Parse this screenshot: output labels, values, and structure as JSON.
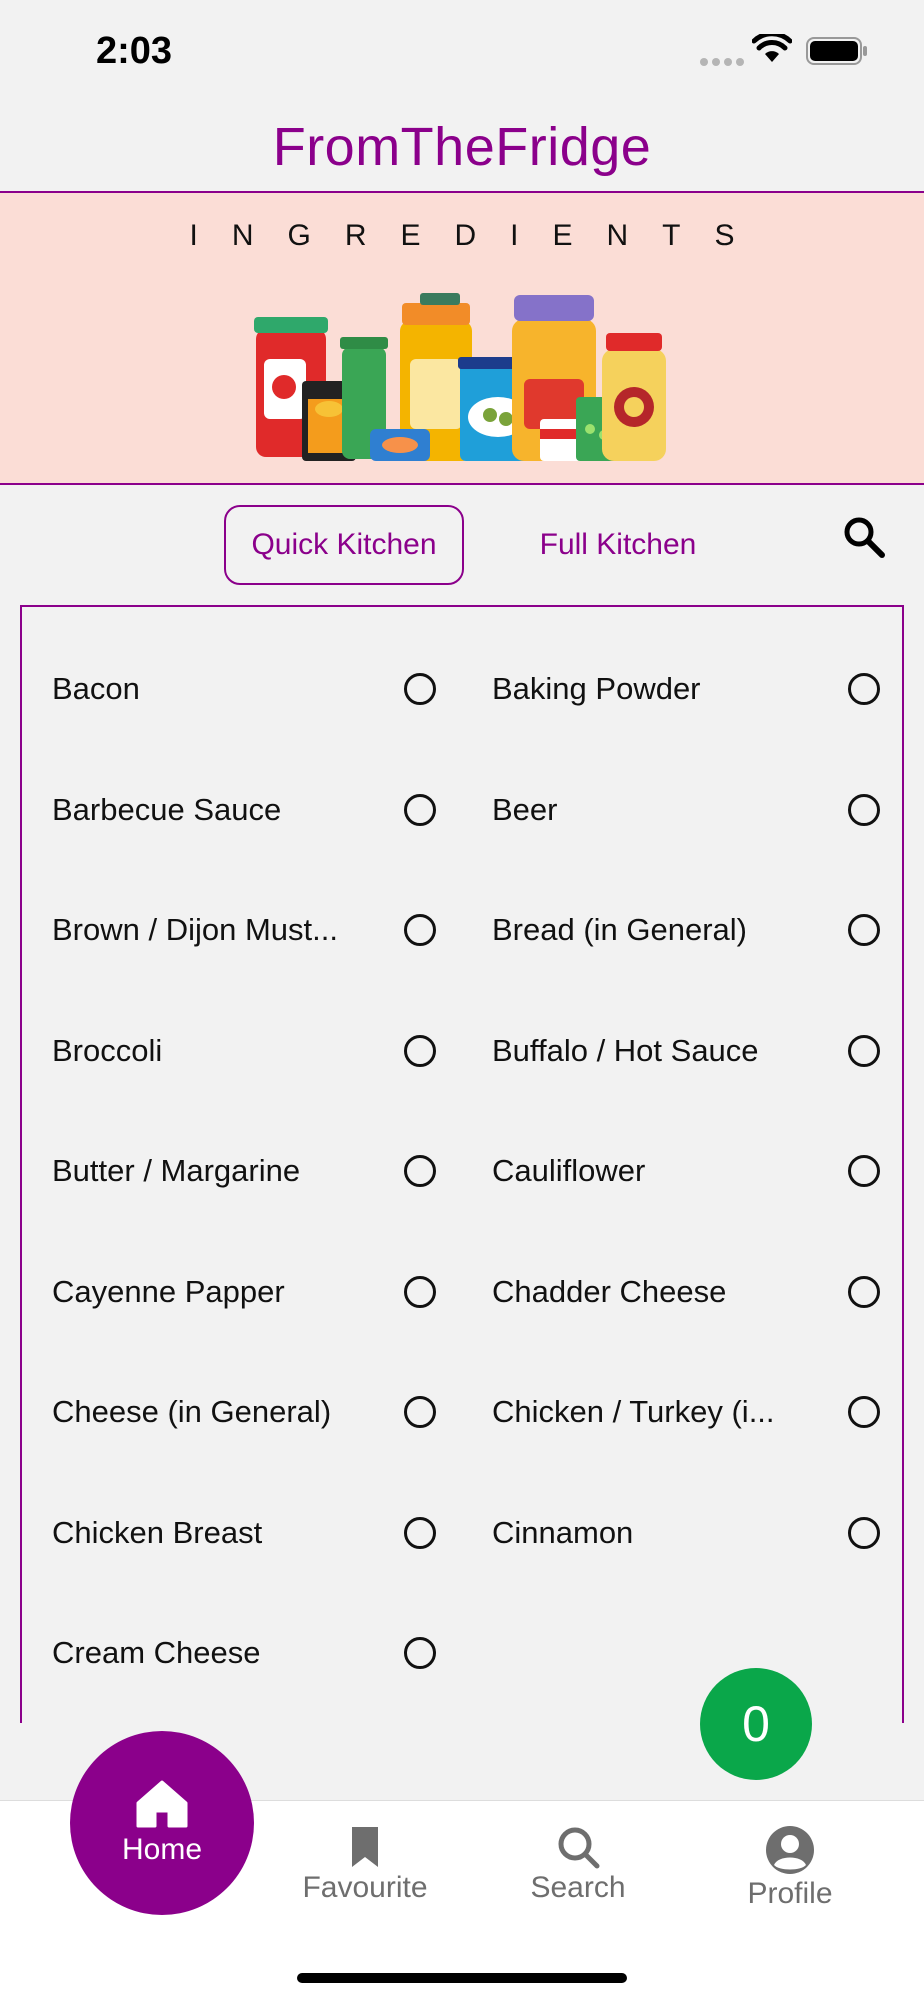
{
  "status_bar": {
    "time": "2:03"
  },
  "header": {
    "title": "FromTheFridge"
  },
  "banner": {
    "title": "INGREDIENTS"
  },
  "tabs": {
    "quick_label": "Quick Kitchen",
    "full_label": "Full Kitchen"
  },
  "ingredients": [
    {
      "label": "Bacon",
      "selected": false
    },
    {
      "label": "Baking Powder",
      "selected": false
    },
    {
      "label": "Barbecue Sauce",
      "selected": false
    },
    {
      "label": "Beer",
      "selected": false
    },
    {
      "label": "Brown / Dijon Must...",
      "selected": false
    },
    {
      "label": "Bread (in General)",
      "selected": false
    },
    {
      "label": "Broccoli",
      "selected": false
    },
    {
      "label": "Buffalo / Hot Sauce",
      "selected": false
    },
    {
      "label": "Butter / Margarine",
      "selected": false
    },
    {
      "label": "Cauliflower",
      "selected": false
    },
    {
      "label": "Cayenne Papper",
      "selected": false
    },
    {
      "label": "Chadder Cheese",
      "selected": false
    },
    {
      "label": "Cheese (in General)",
      "selected": false
    },
    {
      "label": "Chicken / Turkey (i...",
      "selected": false
    },
    {
      "label": "Chicken Breast",
      "selected": false
    },
    {
      "label": "Cinnamon",
      "selected": false
    },
    {
      "label": "Cream Cheese",
      "selected": false
    }
  ],
  "selected_count": "0",
  "bottom_nav": {
    "home": "Home",
    "favourite": "Favourite",
    "search": "Search",
    "profile": "Profile"
  },
  "colors": {
    "brand": "#8b008b",
    "banner_bg": "#fbddd6",
    "badge": "#0aa74a"
  }
}
